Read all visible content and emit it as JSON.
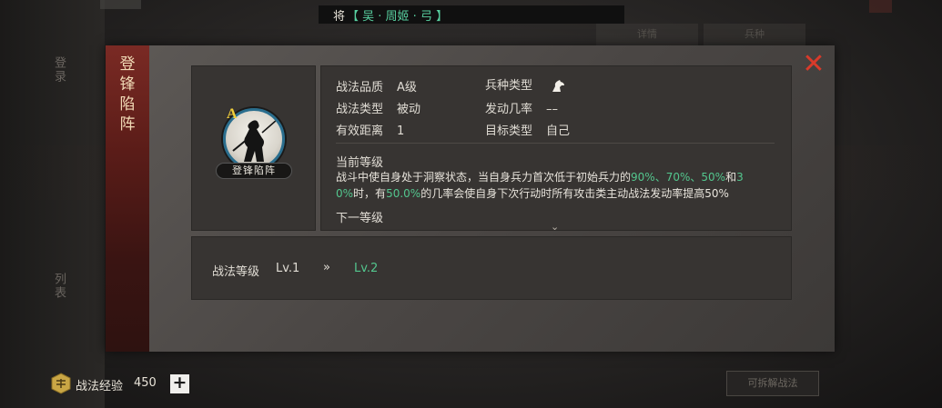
{
  "general": {
    "label": "将",
    "name": "【 吴 · 周姬 · 弓 】"
  },
  "tactic": {
    "title": "登锋陷阵",
    "name": "登锋陷阵",
    "grade": "A",
    "attributes": {
      "quality_label": "战法品质",
      "quality_value": "A级",
      "type_label": "战法类型",
      "type_value": "被动",
      "range_label": "有效距离",
      "range_value": "1",
      "troop_label": "兵种类型",
      "troop_icon": "horse-icon",
      "rate_label": "发动几率",
      "rate_value": "––",
      "target_label": "目标类型",
      "target_value": "自己"
    },
    "current_level_label": "当前等级",
    "description": {
      "p1": "战斗中使自身处于洞察状态，当自身兵力首次低于初始兵力的",
      "v1": "90%",
      "s1": "、",
      "v2": "70%",
      "s2": "、",
      "v3": "50%",
      "s3": "和",
      "v4a": "3",
      "v4b": "0%",
      "p2": "时，有",
      "v5": "50.0%",
      "p3": "的几率会使自身下次行动时所有攻击类主动战法发动率提高50%"
    },
    "next_level_label": "下一等级"
  },
  "level": {
    "label": "战法等级",
    "current": "Lv.1",
    "arrow": "»",
    "next": "Lv.2"
  },
  "exp": {
    "label": "战法经验",
    "value": "450",
    "add": "+"
  },
  "background": {
    "left_tab_1": "登录",
    "left_tab_2": "列表",
    "top_tab_1": "详情",
    "top_tab_2": "兵种",
    "bottom_button": "可拆解战法"
  },
  "colors": {
    "accent_green": "#53c68e",
    "close_red": "#d93a2a",
    "grade_gold": "#f2cf3a"
  }
}
